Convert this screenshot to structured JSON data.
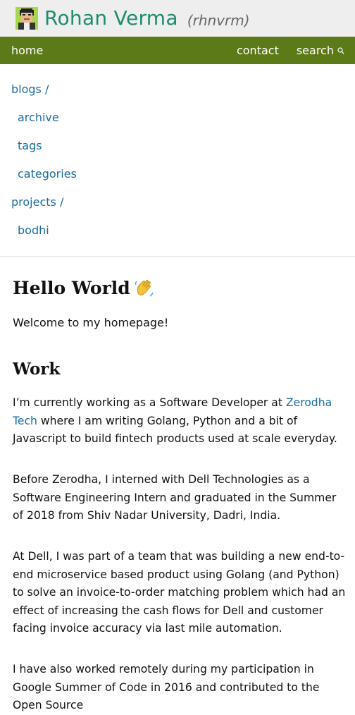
{
  "header": {
    "site_title": "Rohan Verma",
    "handle": "(rhnvrm)",
    "avatar_icon": "pixel-avatar-icon"
  },
  "nav": {
    "home": "home",
    "contact": "contact",
    "search": "search",
    "search_icon": "magnifier-icon"
  },
  "sidebar": {
    "blogs": "blogs /",
    "archive": "archive",
    "tags": "tags",
    "categories": "categories",
    "projects": "projects /",
    "bodhi": "bodhi"
  },
  "main": {
    "title": "Hello World",
    "wave_icon": "waving-hand-icon",
    "welcome": "Welcome to my homepage!",
    "work_heading": "Work",
    "p1_before": "I’m currently working as a Software Developer at",
    "p1_link": "Zerodha Tech",
    "p1_after": "where I am writing Golang, Python and a bit of Javascript to build fintech products used at scale everyday.",
    "p2": "Before Zerodha, I interned with Dell Technologies as a Software Engineering Intern and graduated in the Summer of 2018 from Shiv Nadar University, Dadri, India.",
    "p3": "At Dell, I was part of a team that was building a new end-to-end microservice based product using Golang (and Python) to solve an invoice-to-order matching problem which had an effect of increasing the cash flows for Dell and customer facing invoice accuracy via last mile automation.",
    "p4": "I have also worked remotely during my participation in Google Summer of Code in 2016 and contributed to the Open Source"
  },
  "colors": {
    "title_green": "#1d8c6e",
    "nav_green": "#5d7a19",
    "link_blue": "#1a6aa0"
  }
}
